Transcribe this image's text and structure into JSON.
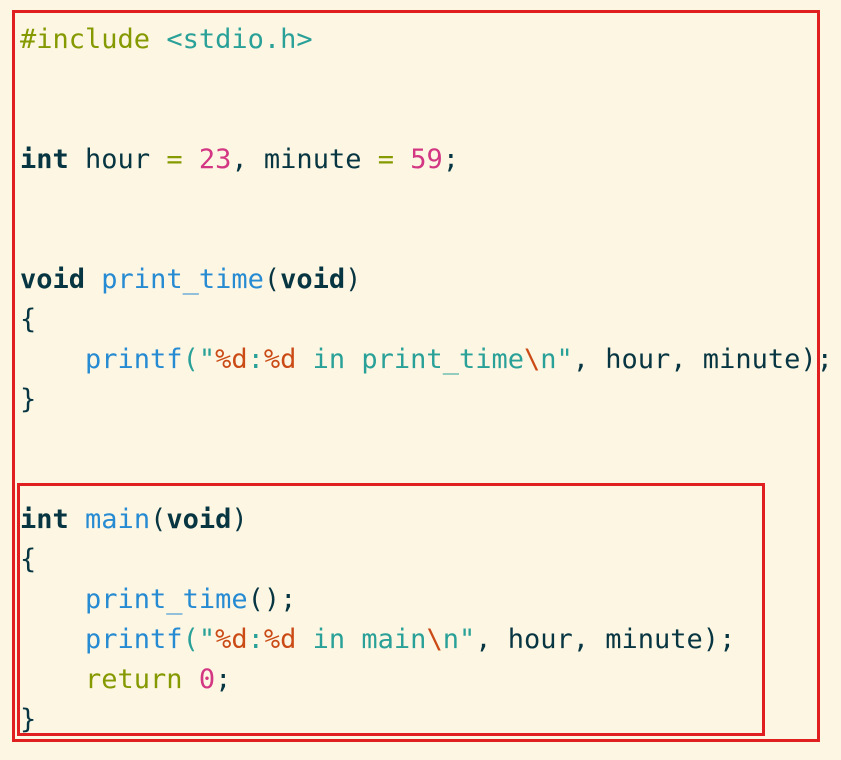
{
  "code": {
    "include_directive": "#include",
    "include_header": "<stdio.h>",
    "line3": {
      "type": "int",
      "var1": "hour",
      "eq1": "=",
      "val1": "23",
      "comma": ",",
      "var2": "minute",
      "eq2": "=",
      "val2": "59",
      "semi": ";"
    },
    "print_time_decl": {
      "ret_type": "void",
      "name": "print_time",
      "open_paren": "(",
      "param": "void",
      "close_paren": ")"
    },
    "brace_open": "{",
    "brace_close": "}",
    "printf1": {
      "fn": "printf",
      "open": "(\"",
      "fmt1": "%d",
      "colon": ":",
      "fmt2": "%d",
      "text": " in print_time",
      "esc_slash": "\\",
      "esc_n": "n",
      "close_quote": "\"",
      "args": ", hour, minute);"
    },
    "main_decl": {
      "ret_type": "int",
      "name": "main",
      "open_paren": "(",
      "param": "void",
      "close_paren": ")"
    },
    "call_print_time": {
      "fn": "print_time",
      "rest": "();"
    },
    "printf2": {
      "fn": "printf",
      "open": "(\"",
      "fmt1": "%d",
      "colon": ":",
      "fmt2": "%d",
      "text": " in main",
      "esc_slash": "\\",
      "esc_n": "n",
      "close_quote": "\"",
      "args": ", hour, minute);"
    },
    "return_stmt": {
      "kw": "return",
      "val": "0",
      "semi": ";"
    }
  },
  "colors": {
    "background": "#fdf6e3",
    "highlight_border": "#e02020",
    "keyword": "#073642",
    "preprocessor": "#859900",
    "string": "#2aa198",
    "function": "#268bd2",
    "number": "#d33682",
    "format": "#cb4b16"
  }
}
